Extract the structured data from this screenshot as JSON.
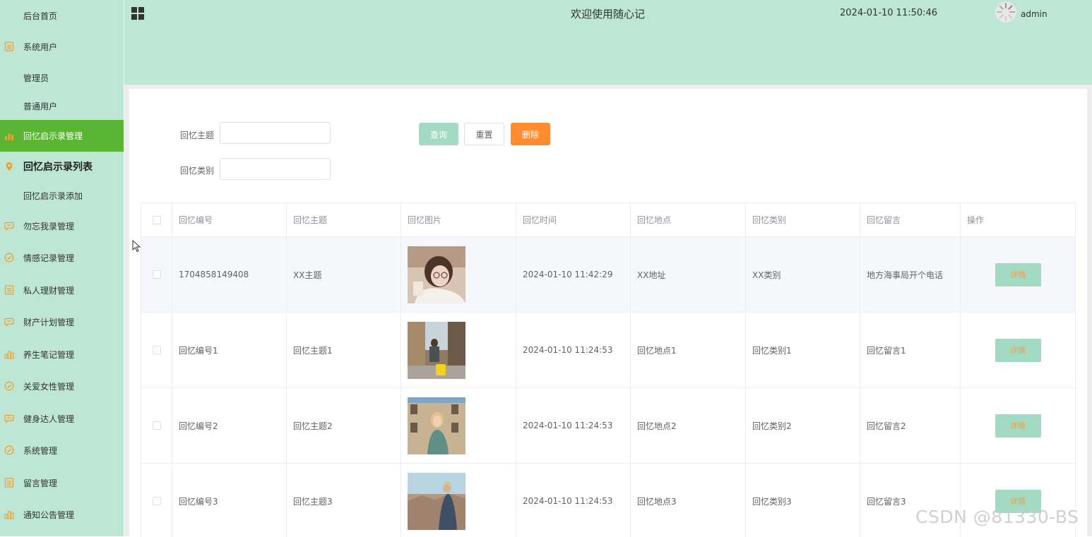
{
  "header": {
    "title": "欢迎使用随心记",
    "datetime": "2024-01-10 11:50:46",
    "username": "admin"
  },
  "sidebar": {
    "items": [
      {
        "label": "后台首页",
        "icon": "none"
      },
      {
        "label": "系统用户",
        "icon": "document-icon"
      },
      {
        "label": "管理员",
        "icon": "none"
      },
      {
        "label": "普通用户",
        "icon": "none"
      },
      {
        "label": "回忆启示录管理",
        "icon": "bar-chart-icon",
        "state": "active"
      },
      {
        "label": "回忆启示录列表",
        "icon": "location-pin-icon",
        "state": "current"
      },
      {
        "label": "回忆启示录添加",
        "icon": "none"
      },
      {
        "label": "勿忘我录管理",
        "icon": "chat-bubble-icon"
      },
      {
        "label": "情感记录管理",
        "icon": "check-circle-icon"
      },
      {
        "label": "私人理财管理",
        "icon": "document-icon"
      },
      {
        "label": "财产计划管理",
        "icon": "chat-bubble-icon"
      },
      {
        "label": "养生笔记管理",
        "icon": "bar-chart-icon"
      },
      {
        "label": "关爱女性管理",
        "icon": "check-circle-icon"
      },
      {
        "label": "健身达人管理",
        "icon": "chat-bubble-icon"
      },
      {
        "label": "系统管理",
        "icon": "check-circle-icon"
      },
      {
        "label": "留言管理",
        "icon": "document-icon"
      },
      {
        "label": "通知公告管理",
        "icon": "bar-chart-icon"
      }
    ]
  },
  "search": {
    "topic_label": "回忆主题",
    "topic_value": "",
    "category_label": "回忆类别",
    "category_value": "",
    "query_button": "查询",
    "reset_button": "重置",
    "delete_button": "删除"
  },
  "table": {
    "columns": [
      "回忆编号",
      "回忆主题",
      "回忆图片",
      "回忆时间",
      "回忆地点",
      "回忆类别",
      "回忆留言",
      "操作"
    ],
    "rows": [
      {
        "id": "1704858149408",
        "topic": "XX主题",
        "time": "2024-01-10 11:42:29",
        "place": "XX地址",
        "category": "XX类别",
        "message": "地方海事局开个电话",
        "action": "详情"
      },
      {
        "id": "回忆编号1",
        "topic": "回忆主题1",
        "time": "2024-01-10 11:24:53",
        "place": "回忆地点1",
        "category": "回忆类别1",
        "message": "回忆留言1",
        "action": "详情"
      },
      {
        "id": "回忆编号2",
        "topic": "回忆主题2",
        "time": "2024-01-10 11:24:53",
        "place": "回忆地点2",
        "category": "回忆类别2",
        "message": "回忆留言2",
        "action": "详情"
      },
      {
        "id": "回忆编号3",
        "topic": "回忆主题3",
        "time": "2024-01-10 11:24:53",
        "place": "回忆地点3",
        "category": "回忆类别3",
        "message": "回忆留言3",
        "action": "详情"
      }
    ]
  },
  "watermark": "CSDN @81330-BS",
  "colors": {
    "sidebar_bg": "#bde6d4",
    "active_bg": "#5bb535",
    "icon_color": "#f0a030",
    "primary_button": "#a3dac4",
    "delete_button": "#ff8c2e"
  }
}
